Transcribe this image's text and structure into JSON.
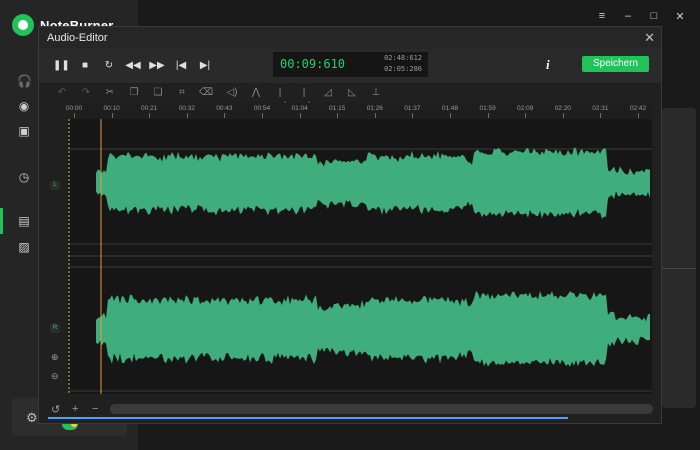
{
  "app": {
    "brand": "NoteBurner",
    "window_controls": [
      "≡",
      "–",
      "□",
      "✕"
    ]
  },
  "dialog": {
    "title": "Audio-Editor",
    "close_glyph": "✕"
  },
  "transport": {
    "pause_glyph": "❚❚",
    "stop_glyph": "■",
    "loop_glyph": "↻",
    "rewind_glyph": "◀◀",
    "forward_glyph": "▶▶",
    "prev_glyph": "|◀",
    "next_glyph": "▶|",
    "current_time": "00:09:610",
    "total_time": "02:48:612",
    "selection_time": "02:05:286",
    "info_glyph": "i",
    "save_label": "Speichern"
  },
  "ruler": {
    "ticks": [
      "00:00",
      "00:10",
      "00:21",
      "00:32",
      "00:43",
      "00:54",
      "01:04",
      "01:15",
      "01:26",
      "01:37",
      "01:48",
      "01:59",
      "02:09",
      "02:20",
      "02:31",
      "02:42"
    ]
  },
  "tracks": {
    "left_label": "L",
    "right_label": "R"
  },
  "colors": {
    "accent": "#20c25a",
    "waveform": "#3fae7c",
    "time_green": "#1fd36a",
    "playhead": "#e39b3a"
  },
  "bottom": {
    "undo_glyph": "↺",
    "zoom_in_glyph": "+",
    "zoom_out_glyph": "−"
  }
}
